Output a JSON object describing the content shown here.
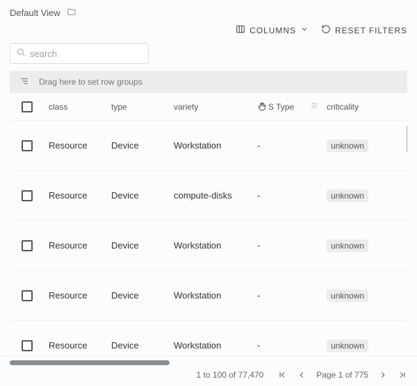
{
  "title": "Default View",
  "toolbar": {
    "columns_label": "COLUMNS",
    "reset_label": "RESET FILTERS"
  },
  "search": {
    "placeholder": "search",
    "value": ""
  },
  "group_drop_hint": "Drag here to set row groups",
  "columns": {
    "class": "class",
    "type": "type",
    "variety": "variety",
    "os_type_suffix": "S Type",
    "criticality": "criticality"
  },
  "rows": [
    {
      "class": "Resource",
      "type": "Device",
      "variety": "Workstation",
      "os_type": "-",
      "criticality": "unknown"
    },
    {
      "class": "Resource",
      "type": "Device",
      "variety": "compute-disks",
      "os_type": "-",
      "criticality": "unknown"
    },
    {
      "class": "Resource",
      "type": "Device",
      "variety": "Workstation",
      "os_type": "-",
      "criticality": "unknown"
    },
    {
      "class": "Resource",
      "type": "Device",
      "variety": "Workstation",
      "os_type": "-",
      "criticality": "unknown"
    },
    {
      "class": "Resource",
      "type": "Device",
      "variety": "Workstation",
      "os_type": "-",
      "criticality": "unknown"
    }
  ],
  "pagination": {
    "range_text": "1 to 100 of 77,470",
    "page_text": "Page 1 of 775"
  }
}
